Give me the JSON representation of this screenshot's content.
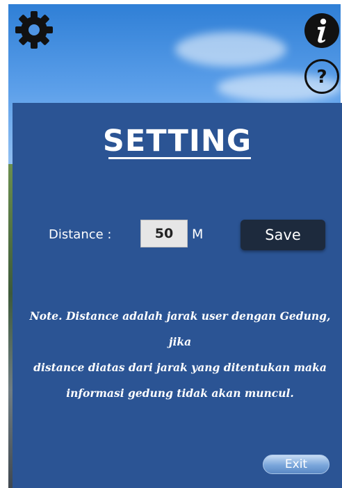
{
  "settings_panel": {
    "title": "SETTING",
    "distance_label": "Distance :",
    "distance_value": "50",
    "distance_unit": "M",
    "save_label": "Save",
    "note_lines": [
      "Note. Distance adalah jarak user dengan Gedung, jika",
      "distance diatas dari jarak yang ditentukan maka",
      "informasi gedung tidak akan muncul."
    ],
    "exit_label": "Exit"
  },
  "icons": {
    "settings": "gear-icon",
    "info": "info-icon",
    "help": "help-icon"
  },
  "colors": {
    "panel": "#2b5494",
    "save_button": "#1d2a3d",
    "exit_button": "#7aa6db"
  }
}
